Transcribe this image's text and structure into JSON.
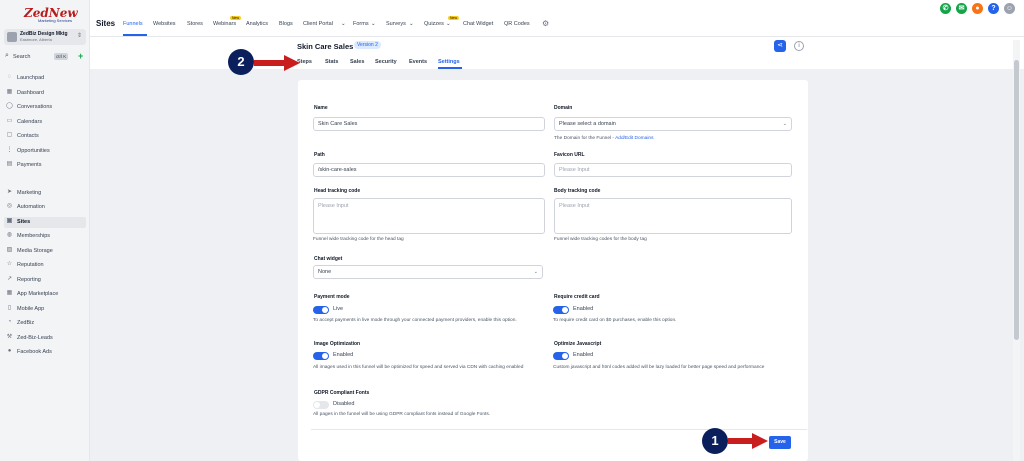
{
  "brand": {
    "logo_text": "ZedNew",
    "logo_sub": "Marketing Services"
  },
  "account": {
    "name": "ZedBiz Design Mktg",
    "location": "Eastmore, Alberta"
  },
  "search": {
    "label": "Search",
    "shortcut": "ctrl K"
  },
  "sidebar": {
    "items": [
      {
        "label": "Launchpad",
        "icon": "rocket-icon"
      },
      {
        "label": "Dashboard",
        "icon": "dashboard-icon"
      },
      {
        "label": "Conversations",
        "icon": "chat-icon"
      },
      {
        "label": "Calendars",
        "icon": "calendar-icon"
      },
      {
        "label": "Contacts",
        "icon": "contacts-icon"
      },
      {
        "label": "Opportunities",
        "icon": "opportunities-icon"
      },
      {
        "label": "Payments",
        "icon": "payments-icon"
      },
      {
        "label": "Marketing",
        "icon": "send-icon"
      },
      {
        "label": "Automation",
        "icon": "automation-icon"
      },
      {
        "label": "Sites",
        "icon": "sites-icon"
      },
      {
        "label": "Memberships",
        "icon": "membership-icon"
      },
      {
        "label": "Media Storage",
        "icon": "media-icon"
      },
      {
        "label": "Reputation",
        "icon": "star-icon"
      },
      {
        "label": "Reporting",
        "icon": "chart-icon"
      },
      {
        "label": "App Marketplace",
        "icon": "grid-icon"
      },
      {
        "label": "Mobile App",
        "icon": "mobile-icon"
      },
      {
        "label": "ZedBiz",
        "icon": "zedbiz-icon"
      },
      {
        "label": "Zed-Biz-Leads",
        "icon": "wrench-icon"
      },
      {
        "label": "Facebook Ads",
        "icon": "facebook-icon"
      }
    ]
  },
  "topbar": {
    "title": "Sites",
    "nav": [
      "Funnels",
      "Websites",
      "Stores",
      "Webinars",
      "Analytics",
      "Blogs",
      "Client Portal",
      "Forms",
      "Surveys",
      "Quizzes",
      "Chat Widget",
      "QR Codes"
    ],
    "badge": "New"
  },
  "funnel": {
    "title": "Skin Care Sales",
    "version": "Version 2"
  },
  "subtabs": [
    "Steps",
    "Stats",
    "Sales",
    "Security",
    "Events",
    "Settings"
  ],
  "form": {
    "name_label": "Name",
    "name_value": "Skin Care Sales",
    "domain_label": "Domain",
    "domain_placeholder": "Please select a domain",
    "domain_help": "The Domain for the Funnel -",
    "domain_link": "Add/Edit Domains",
    "path_label": "Path",
    "path_value": "/skin-care-sales",
    "favicon_label": "Favicon URL",
    "favicon_placeholder": "Please Input",
    "head_label": "Head tracking code",
    "head_placeholder": "Please Input",
    "head_help": "Funnel wide tracking code for the head tag",
    "body_label": "Body tracking code",
    "body_placeholder": "Please Input",
    "body_help": "Funnel wide tracking codes for the body tag",
    "chat_label": "Chat widget",
    "chat_value": "None",
    "payment_label": "Payment mode",
    "payment_state": "Live",
    "payment_help": "To accept payments in live mode through your connected payment providers, enable this option.",
    "credit_label": "Require credit card",
    "credit_state": "Enabled",
    "credit_help": "To require credit card on $0 purchases, enable this option.",
    "image_label": "Image Optimization",
    "image_state": "Enabled",
    "image_help": "All images used in this funnel will be optimized for speed and served via CDN with caching enabled",
    "js_label": "Optimize Javascript",
    "js_state": "Enabled",
    "js_help": "Custom javascript and html codes added will be lazy loaded for better page speed and performance",
    "gdpr_label": "GDPR Compliant Fonts",
    "gdpr_state": "Disabled",
    "gdpr_help": "All pages in the funnel will be using GDPR compliant fonts instead of Google Fonts.",
    "save_label": "Save"
  },
  "annotations": {
    "step1": "1",
    "step2": "2"
  },
  "colors": {
    "accent": "#2563eb",
    "annotation_circle": "#0b1f5c",
    "annotation_arrow": "#c81e1e"
  }
}
